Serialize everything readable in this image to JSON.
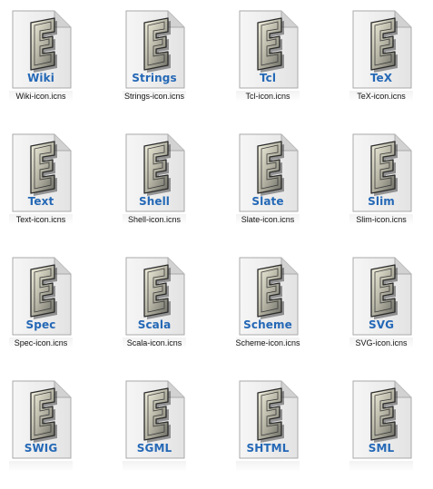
{
  "files": [
    {
      "label": "Wiki",
      "name": "Wiki-icon.icns"
    },
    {
      "label": "Strings",
      "name": "Strings-icon.icns"
    },
    {
      "label": "Tcl",
      "name": "Tcl-icon.icns"
    },
    {
      "label": "TeX",
      "name": "TeX-icon.icns"
    },
    {
      "label": "Text",
      "name": "Text-icon.icns"
    },
    {
      "label": "Shell",
      "name": "Shell-icon.icns"
    },
    {
      "label": "Slate",
      "name": "Slate-icon.icns"
    },
    {
      "label": "Slim",
      "name": "Slim-icon.icns"
    },
    {
      "label": "Spec",
      "name": "Spec-icon.icns"
    },
    {
      "label": "Scala",
      "name": "Scala-icon.icns"
    },
    {
      "label": "Scheme",
      "name": "Scheme-icon.icns"
    },
    {
      "label": "SVG",
      "name": "SVG-icon.icns"
    },
    {
      "label": "SWIG"
    },
    {
      "label": "SGML"
    },
    {
      "label": "SHTML"
    },
    {
      "label": "SML"
    }
  ],
  "icon": "emacs-document-icon",
  "colors": {
    "label": "#2468b6",
    "background": "#ffffff"
  }
}
